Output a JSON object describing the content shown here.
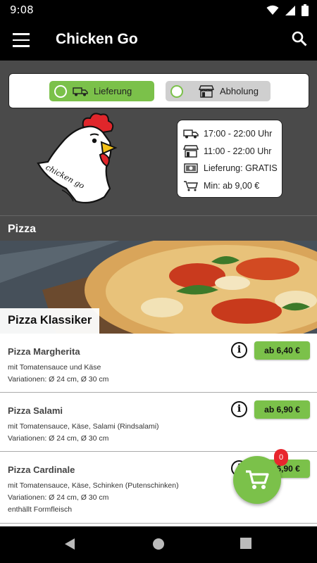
{
  "status": {
    "time": "9:08"
  },
  "app": {
    "title": "Chicken Go"
  },
  "mode": {
    "delivery_label": "Lieferung",
    "pickup_label": "Abholung",
    "selected": "delivery"
  },
  "logo": {
    "text": "chicken go"
  },
  "info": {
    "delivery_hours": "17:00 - 22:00 Uhr",
    "pickup_hours": "11:00 - 22:00 Uhr",
    "delivery_fee": "Lieferung: GRATIS",
    "min_order": "Min: ab 9,00 €"
  },
  "section": {
    "title": "Pizza"
  },
  "category": {
    "title": "Pizza Klassiker"
  },
  "products": [
    {
      "name": "Pizza Margherita",
      "desc": [
        "mit Tomatensauce und Käse",
        "Variationen: Ø 24 cm, Ø 30 cm"
      ],
      "price": "ab 6,40 €"
    },
    {
      "name": "Pizza Salami",
      "desc": [
        "mit Tomatensauce, Käse, Salami (Rindsalami)",
        "Variationen: Ø 24 cm, Ø 30 cm"
      ],
      "price": "ab 6,90 €"
    },
    {
      "name": "Pizza Cardinale",
      "desc": [
        "mit Tomatensauce, Käse, Schinken (Putenschinken)",
        "Variationen: Ø 24 cm, Ø 30 cm",
        "enthällt Formfleisch"
      ],
      "price": "ab 6,90 €"
    }
  ],
  "cart": {
    "count": "0"
  },
  "colors": {
    "accent": "#7bc14a",
    "badge": "#e8262e",
    "header": "#4a4a4a"
  }
}
